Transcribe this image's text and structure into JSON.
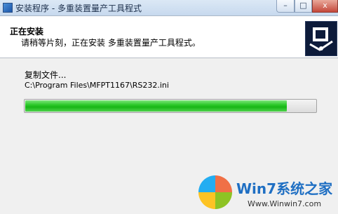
{
  "window": {
    "title": "安装程序 - 多重装置量产工具程式",
    "min_symbol": "–",
    "max_symbol": "□",
    "close_symbol": "x"
  },
  "header": {
    "title": "正在安装",
    "subtitle": "请稍等片刻，正在安装 多重装置量产工具程式。"
  },
  "progress_area": {
    "status": "复制文件...",
    "file_path": "C:\\Program Files\\MFPT1167\\RS232.ini",
    "progress_fraction": 0.9
  },
  "watermark": {
    "brand": "Win7系统之家",
    "url": "Www.Winwin7.com"
  }
}
